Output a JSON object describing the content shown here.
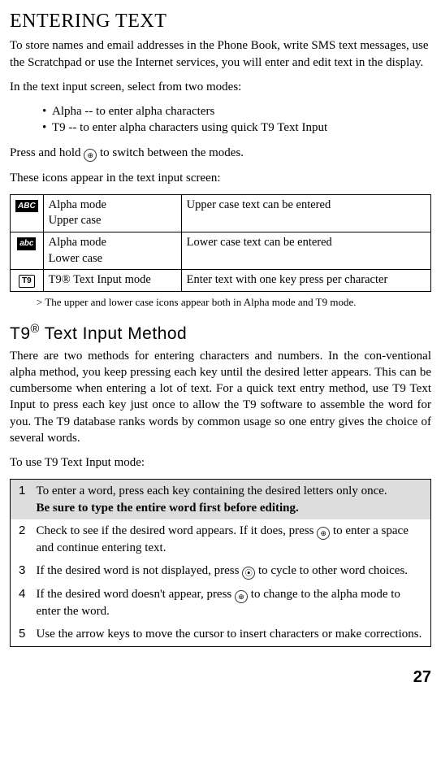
{
  "title": "ENTERING TEXT",
  "intro": "To store names and email addresses in the Phone Book, write SMS text messages, use the Scratchpad or use the Internet services, you will enter and edit text in the display.",
  "modes_lead": "In the text input screen, select from two modes:",
  "modes": [
    "Alpha -- to enter alpha characters",
    "T9 -- to enter alpha characters using quick T9 Text Input"
  ],
  "hold_pre": "Press and hold ",
  "hold_key_glyph": "⊕",
  "hold_post": " to switch between the modes.",
  "icons_lead": "These icons appear in the text input screen:",
  "icon_table": [
    {
      "glyph": "ABC",
      "glyph_kind": "abc-upper",
      "mode": "Alpha mode\nUpper case",
      "desc": "Upper case text can be entered"
    },
    {
      "glyph": "abc",
      "glyph_kind": "abc-lower",
      "mode": "Alpha mode\nLower case",
      "desc": "Lower case text can be entered"
    },
    {
      "glyph": "T9",
      "glyph_kind": "t9",
      "mode": "T9® Text Input mode",
      "desc": "Enter text with one key press per character"
    }
  ],
  "note_prefix": "> ",
  "note": "The upper and lower case icons appear both in Alpha mode and T9 mode.",
  "h2_pre": "T9",
  "h2_sup": "®",
  "h2_post": " Text Input Method",
  "t9_para": "There are two methods for entering characters and numbers. In the con-ventional alpha method, you keep pressing each key until the desired letter appears. This can be cumbersome when entering a lot of text. For a quick text entry method, use T9 Text Input to press each key just once to allow the T9 software to assemble the word for you. The T9 database ranks words by common usage so one entry gives the choice of several words.",
  "t9_use_lead": "To use T9 Text Input mode:",
  "steps": [
    {
      "n": "1",
      "text": "To enter a word, press each key containing the desired letters only once.",
      "bold_after": "Be sure to type the entire word first before editing."
    },
    {
      "n": "2",
      "pre": "Check to see if the desired word appears. If it does, press ",
      "key": "⊕",
      "post": " to enter a space and continue entering text."
    },
    {
      "n": "3",
      "pre": "If the desired word is not displayed, press ",
      "key": "⦿",
      "post": " to cycle to other word choices."
    },
    {
      "n": "4",
      "pre": "If the desired word doesn't appear, press ",
      "key": "⊕",
      "post": " to change to the alpha mode to enter the word."
    },
    {
      "n": "5",
      "text": "Use the arrow keys to move the cursor to insert characters or make corrections."
    }
  ],
  "page_number": "27"
}
